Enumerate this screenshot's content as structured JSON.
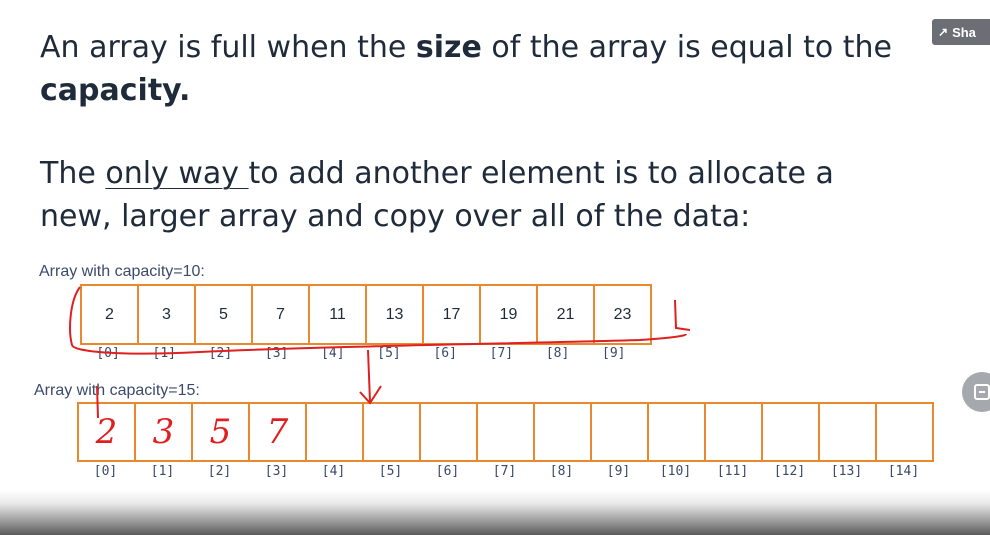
{
  "slide": {
    "line1_prefix": "An array is full when the ",
    "line1_bold": "size",
    "line1_suffix": " of the array is equal to the",
    "line2_bold": "capacity",
    "line2_suffix": ".",
    "line3_prefix": "The ",
    "line3_underlined": "only way ",
    "line3_suffix": "to add another element is to allocate a",
    "line4": "new, larger array and copy over all of the data:"
  },
  "array_old": {
    "label": "Array with capacity=10:",
    "values": [
      "2",
      "3",
      "5",
      "7",
      "11",
      "13",
      "17",
      "19",
      "21",
      "23"
    ],
    "indices": [
      "[0]",
      "[1]",
      "[2]",
      "[3]",
      "[4]",
      "[5]",
      "[6]",
      "[7]",
      "[8]",
      "[9]"
    ]
  },
  "array_new": {
    "label": "Array with capacity=15:",
    "handwritten_values": [
      "2",
      "3",
      "5",
      "7",
      "",
      "",
      "",
      "",
      "",
      "",
      "",
      "",
      "",
      "",
      ""
    ],
    "indices": [
      "[0]",
      "[1]",
      "[2]",
      "[3]",
      "[4]",
      "[5]",
      "[6]",
      "[7]",
      "[8]",
      "[9]",
      "[10]",
      "[11]",
      "[12]",
      "[13]",
      "[14]"
    ]
  },
  "overlay": {
    "share_label": "Sha",
    "share_icon": "share-icon",
    "side_icon": "watch-later-icon"
  },
  "colors": {
    "cell_border": "#e9892e",
    "annotation": "#e02020",
    "text": "#1f2b3a"
  }
}
